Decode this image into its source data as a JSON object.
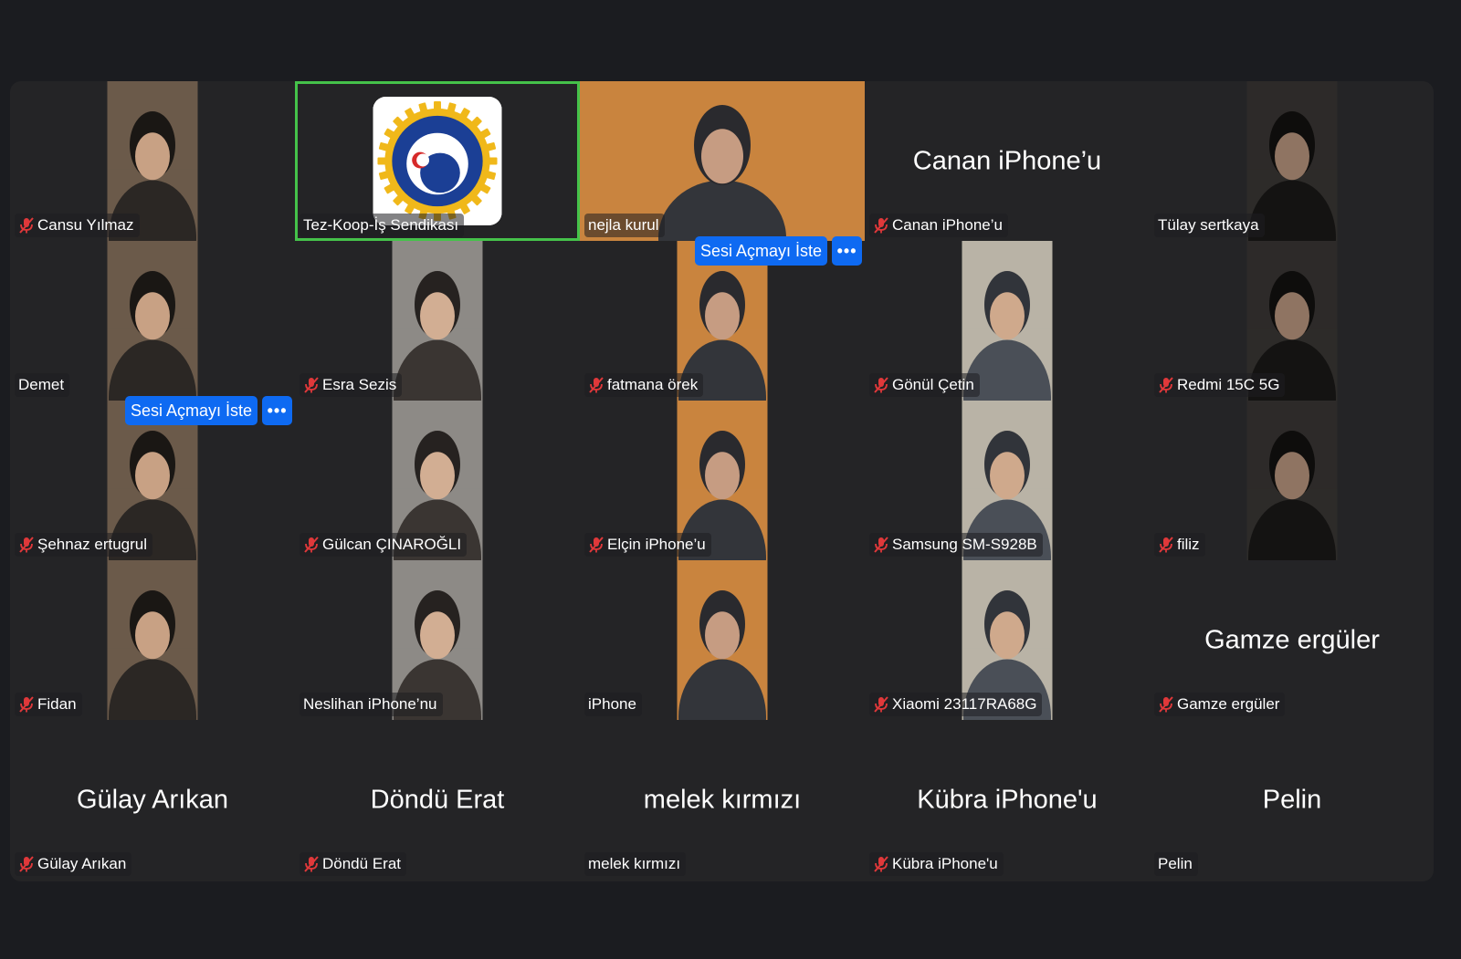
{
  "controls": {
    "ask_unmute_label": "Sesi Açmayı İste",
    "more_label": "•••"
  },
  "colors": {
    "stage": "#242426",
    "active_speaker": "#45c24a",
    "accent": "#0e6af2",
    "muted_icon": "#e0383a"
  },
  "participants": [
    {
      "name": "Cansu Yılmaz",
      "muted": true,
      "video": "camera",
      "active": false,
      "ask_unmute": false
    },
    {
      "name": "Tez-Koop-İş Sendikası",
      "muted": false,
      "video": "logo",
      "active": true,
      "ask_unmute": false
    },
    {
      "name": "nejla kurul",
      "muted": false,
      "video": "camera-wide",
      "active": false,
      "ask_unmute": false
    },
    {
      "name": "Canan  iPhone’u",
      "muted": true,
      "video": "none",
      "display_name": "Canan  iPhone’u",
      "active": false,
      "ask_unmute": false
    },
    {
      "name": "Tülay sertkaya",
      "muted": false,
      "video": "camera",
      "active": false,
      "ask_unmute": false
    },
    {
      "name": "Demet",
      "muted": false,
      "video": "camera",
      "active": false,
      "ask_unmute": false
    },
    {
      "name": "Esra Sezis",
      "muted": true,
      "video": "camera",
      "active": false,
      "ask_unmute": false
    },
    {
      "name": "fatmana örek",
      "muted": true,
      "video": "camera",
      "active": false,
      "ask_unmute": true
    },
    {
      "name": "Gönül Çetin",
      "muted": true,
      "video": "camera",
      "active": false,
      "ask_unmute": false
    },
    {
      "name": "Redmi 15C 5G",
      "muted": true,
      "video": "camera",
      "active": false,
      "ask_unmute": false
    },
    {
      "name": "Şehnaz ertugrul",
      "muted": true,
      "video": "camera",
      "active": false,
      "ask_unmute": true
    },
    {
      "name": "Gülcan ÇINAROĞLI",
      "muted": true,
      "video": "camera",
      "active": false,
      "ask_unmute": false
    },
    {
      "name": "Elçin iPhone’u",
      "muted": true,
      "video": "camera",
      "active": false,
      "ask_unmute": false
    },
    {
      "name": "Samsung SM-S928B",
      "muted": true,
      "video": "camera",
      "active": false,
      "ask_unmute": false
    },
    {
      "name": "filiz",
      "muted": true,
      "video": "camera",
      "active": false,
      "ask_unmute": false
    },
    {
      "name": "Fidan",
      "muted": true,
      "video": "camera",
      "active": false,
      "ask_unmute": false
    },
    {
      "name": "Neslihan iPhone’nu",
      "muted": false,
      "video": "camera",
      "active": false,
      "ask_unmute": false
    },
    {
      "name": "iPhone",
      "muted": false,
      "video": "camera",
      "active": false,
      "ask_unmute": false
    },
    {
      "name": "Xiaomi 23117RA68G",
      "muted": true,
      "video": "camera",
      "active": false,
      "ask_unmute": false
    },
    {
      "name": "Gamze ergüler",
      "muted": true,
      "video": "none",
      "display_name": "Gamze ergüler",
      "active": false,
      "ask_unmute": false
    },
    {
      "name": "Gülay Arıkan",
      "muted": true,
      "video": "none",
      "display_name": "Gülay Arıkan",
      "active": false,
      "ask_unmute": false
    },
    {
      "name": "Döndü Erat",
      "muted": true,
      "video": "none",
      "display_name": "Döndü Erat",
      "active": false,
      "ask_unmute": false
    },
    {
      "name": "melek kırmızı",
      "muted": false,
      "video": "none",
      "display_name": "melek kırmızı",
      "active": false,
      "ask_unmute": false
    },
    {
      "name": "Kübra iPhone'u",
      "muted": true,
      "video": "none",
      "display_name": "Kübra iPhone'u",
      "active": false,
      "ask_unmute": false
    },
    {
      "name": "Pelin",
      "muted": false,
      "video": "none",
      "display_name": "Pelin",
      "active": false,
      "ask_unmute": false
    }
  ]
}
